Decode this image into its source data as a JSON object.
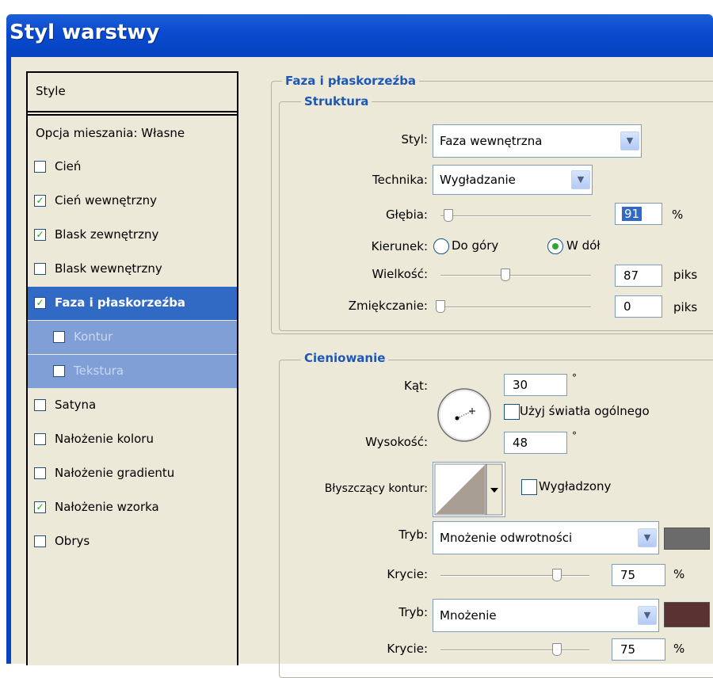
{
  "window": {
    "title": "Styl warstwy"
  },
  "sidebar": {
    "header": "Style",
    "blend_options": "Opcja mieszania: Własne",
    "items": [
      {
        "label": "Cień",
        "checked": false
      },
      {
        "label": "Cień wewnętrzny",
        "checked": true
      },
      {
        "label": "Blask zewnętrzny",
        "checked": true
      },
      {
        "label": "Blask wewnętrzny",
        "checked": false
      },
      {
        "label": "Faza i płaskorzeźba",
        "checked": true,
        "selected": true
      },
      {
        "label": "Kontur",
        "checked": false,
        "sub": true
      },
      {
        "label": "Tekstura",
        "checked": false,
        "sub": true
      },
      {
        "label": "Satyna",
        "checked": false
      },
      {
        "label": "Nałożenie koloru",
        "checked": false
      },
      {
        "label": "Nałożenie gradientu",
        "checked": false
      },
      {
        "label": "Nałożenie wzorka",
        "checked": true
      },
      {
        "label": "Obrys",
        "checked": false
      }
    ],
    "check_glyph": "✓"
  },
  "bevel": {
    "title": "Faza i płaskorzeźba",
    "structure": {
      "title": "Struktura",
      "style_label": "Styl:",
      "style_value": "Faza wewnętrzna",
      "technique_label": "Technika:",
      "technique_value": "Wygładzanie",
      "depth_label": "Głębia:",
      "depth_value": "91",
      "depth_unit": "%",
      "depth_slider": 0.05,
      "direction_label": "Kierunek:",
      "direction_up": "Do góry",
      "direction_down": "W dół",
      "direction_selected": "down",
      "size_label": "Wielkość:",
      "size_value": "87",
      "size_unit": "piks",
      "size_slider": 0.43,
      "soften_label": "Zmiękczanie:",
      "soften_value": "0",
      "soften_unit": "piks",
      "soften_slider": 0.0
    },
    "shading": {
      "title": "Cieniowanie",
      "angle_label": "Kąt:",
      "angle_value": "30",
      "angle_unit": "°",
      "global_light_label": "Użyj światła ogólnego",
      "global_light_checked": false,
      "altitude_label": "Wysokość:",
      "altitude_value": "48",
      "altitude_unit": "°",
      "gloss_label": "Błyszczący kontur:",
      "antialiased_label": "Wygładzony",
      "antialiased_checked": false,
      "highlight_mode_label": "Tryb:",
      "highlight_mode_value": "Mnożenie odwrotności",
      "highlight_color": "#6b6b6b",
      "highlight_opacity_label": "Krycie:",
      "highlight_opacity_value": "75",
      "highlight_opacity_unit": "%",
      "shadow_mode_label": "Tryb:",
      "shadow_mode_value": "Mnożenie",
      "shadow_color": "#5a3330",
      "shadow_opacity_label": "Krycie:",
      "shadow_opacity_value": "75",
      "shadow_opacity_unit": "%"
    }
  },
  "icons": {
    "dropdown": "chevron-down-icon",
    "angle": "angle-dial-icon",
    "gloss": "gloss-contour-icon"
  }
}
